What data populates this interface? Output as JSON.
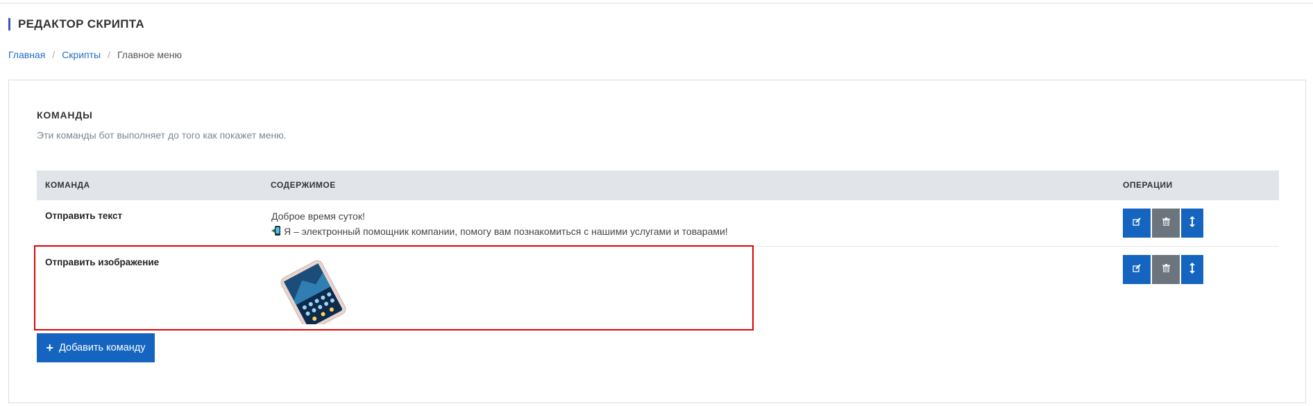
{
  "page": {
    "title": "РЕДАКТОР СКРИПТА"
  },
  "breadcrumb": {
    "home": "Главная",
    "scripts": "Скрипты",
    "current": "Главное меню"
  },
  "commands": {
    "title": "КОМАНДЫ",
    "description": "Эти команды бот выполняет до того как покажет меню.",
    "columns": {
      "command": "КОМАНДА",
      "content": "СОДЕРЖИМОЕ",
      "operations": "ОПЕРАЦИИ"
    },
    "rows": [
      {
        "command": "Отправить текст",
        "content_line1": "Доброе время суток!",
        "content_line2": "Я – электронный помощник компании, помогу вам познакомиться с нашими услугами и товарами!",
        "content_icon": "mobile-phone-arrow-icon"
      },
      {
        "command": "Отправить изображение",
        "content_image": "smartphone-product-image"
      }
    ],
    "add_button": "Добавить команду"
  },
  "colors": {
    "primary": "#1565c0",
    "secondary": "#6c757d",
    "title_accent": "#3f51c7",
    "link": "#1f6fc5",
    "highlight": "#e10000",
    "header_bg": "#e1e4e8"
  },
  "icons": {
    "edit": "edit-icon",
    "delete": "trash-icon",
    "move": "move-vertical-icon",
    "add": "plus-icon"
  }
}
